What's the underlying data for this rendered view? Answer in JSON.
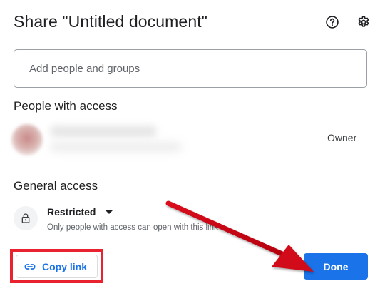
{
  "dialog": {
    "title": "Share \"Untitled document\""
  },
  "header_icons": {
    "help": "help-circle-icon",
    "settings": "gear-icon"
  },
  "add_people": {
    "placeholder": "Add people and groups",
    "value": ""
  },
  "people_section": {
    "heading": "People with access",
    "people": [
      {
        "role": "Owner"
      }
    ]
  },
  "general_access": {
    "heading": "General access",
    "icon": "lock-icon",
    "selected": "Restricted",
    "description": "Only people with access can open with this link"
  },
  "actions": {
    "copy_link_label": "Copy link",
    "copy_link_icon": "link-icon",
    "done_label": "Done"
  },
  "colors": {
    "primary_blue": "#1a73e8",
    "annotation_red": "#e8232f"
  }
}
